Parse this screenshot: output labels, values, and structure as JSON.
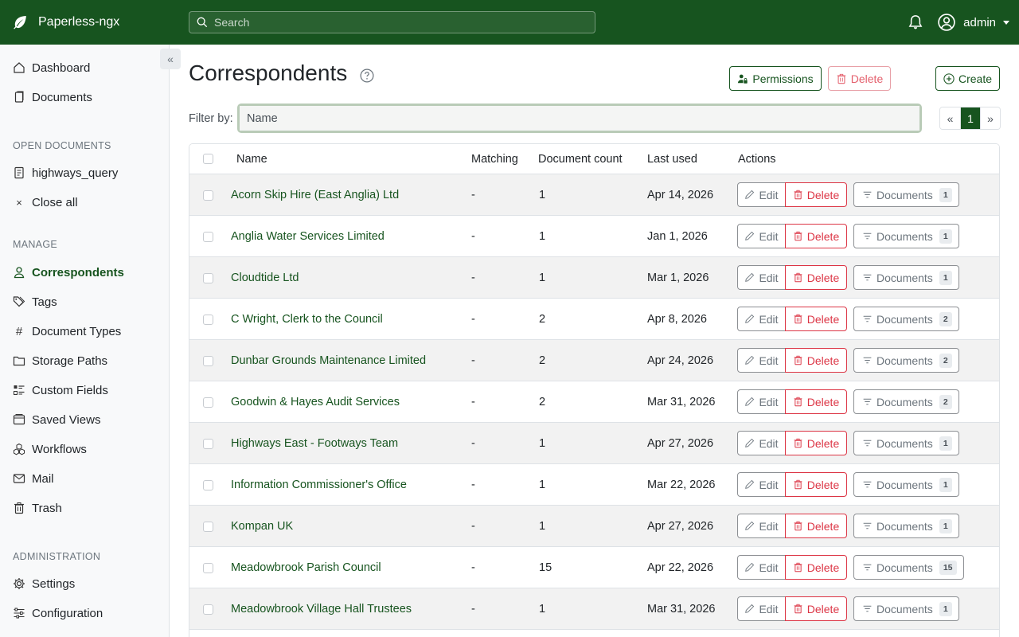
{
  "app": {
    "name": "Paperless-ngx"
  },
  "search": {
    "placeholder": "Search"
  },
  "user": {
    "name": "admin"
  },
  "sidebar": {
    "main": [
      {
        "label": "Dashboard",
        "icon": "house-icon"
      },
      {
        "label": "Documents",
        "icon": "files-icon"
      }
    ],
    "open_heading": "OPEN DOCUMENTS",
    "open": [
      {
        "label": "highways_query",
        "icon": "file-text-icon"
      },
      {
        "label": "Close all",
        "icon": "x-icon"
      }
    ],
    "manage_heading": "MANAGE",
    "manage": [
      {
        "label": "Correspondents",
        "icon": "person-icon",
        "active": true
      },
      {
        "label": "Tags",
        "icon": "tags-icon"
      },
      {
        "label": "Document Types",
        "icon": "hash-icon"
      },
      {
        "label": "Storage Paths",
        "icon": "folder-icon"
      },
      {
        "label": "Custom Fields",
        "icon": "ui-radios-icon"
      },
      {
        "label": "Saved Views",
        "icon": "window-stack-icon"
      },
      {
        "label": "Workflows",
        "icon": "boxes-icon"
      },
      {
        "label": "Mail",
        "icon": "envelope-icon"
      },
      {
        "label": "Trash",
        "icon": "trash-icon"
      }
    ],
    "admin_heading": "ADMINISTRATION",
    "admin": [
      {
        "label": "Settings",
        "icon": "gear-icon"
      },
      {
        "label": "Configuration",
        "icon": "sliders-icon"
      }
    ]
  },
  "page": {
    "title": "Correspondents",
    "permissions_label": "Permissions",
    "delete_label": "Delete",
    "create_label": "Create",
    "filter_label": "Filter by:",
    "filter_placeholder": "Name",
    "pagination": {
      "prev": "«",
      "current": "1",
      "next": "»"
    }
  },
  "table": {
    "columns": [
      "Name",
      "Matching",
      "Document count",
      "Last used",
      "Actions"
    ],
    "edit_label": "Edit",
    "delete_label": "Delete",
    "documents_label": "Documents",
    "rows": [
      {
        "name": "Acorn Skip Hire (East Anglia) Ltd",
        "matching": "-",
        "count": "1",
        "last_used": "Apr 14, 2026"
      },
      {
        "name": "Anglia Water Services Limited",
        "matching": "-",
        "count": "1",
        "last_used": "Jan 1, 2026"
      },
      {
        "name": "Cloudtide Ltd",
        "matching": "-",
        "count": "1",
        "last_used": "Mar 1, 2026"
      },
      {
        "name": "C Wright, Clerk to the Council",
        "matching": "-",
        "count": "2",
        "last_used": "Apr 8, 2026"
      },
      {
        "name": "Dunbar Grounds Maintenance Limited",
        "matching": "-",
        "count": "2",
        "last_used": "Apr 24, 2026"
      },
      {
        "name": "Goodwin & Hayes Audit Services",
        "matching": "-",
        "count": "2",
        "last_used": "Mar 31, 2026"
      },
      {
        "name": "Highways East - Footways Team",
        "matching": "-",
        "count": "1",
        "last_used": "Apr 27, 2026"
      },
      {
        "name": "Information Commissioner's Office",
        "matching": "-",
        "count": "1",
        "last_used": "Mar 22, 2026"
      },
      {
        "name": "Kompan UK",
        "matching": "-",
        "count": "1",
        "last_used": "Apr 27, 2026"
      },
      {
        "name": "Meadowbrook Parish Council",
        "matching": "-",
        "count": "15",
        "last_used": "Apr 22, 2026"
      },
      {
        "name": "Meadowbrook Village Hall Trustees",
        "matching": "-",
        "count": "1",
        "last_used": "Mar 31, 2026"
      }
    ]
  },
  "colors": {
    "brand": "#17541f",
    "danger": "#dc3545"
  }
}
